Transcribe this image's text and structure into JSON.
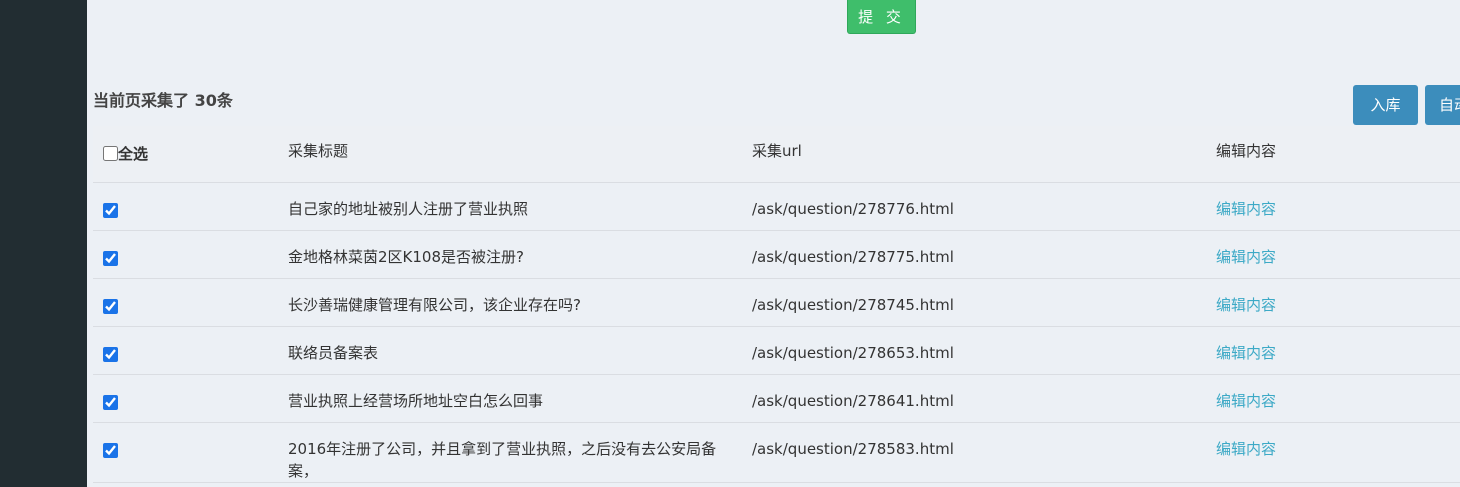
{
  "submit": {
    "label": "提 交",
    "color": "#3fbe6b"
  },
  "summary": {
    "text": "当前页采集了 30条"
  },
  "actions": {
    "import_label": "入库",
    "auto_label": "自动",
    "color": "#3c8dbc"
  },
  "table": {
    "headers": {
      "select_all": "全选",
      "title": "采集标题",
      "url": "采集url",
      "edit": "编辑内容"
    },
    "rows": [
      {
        "checked": true,
        "title": "自己家的地址被别人注册了营业执照",
        "url": "/ask/question/278776.html",
        "edit": "编辑内容"
      },
      {
        "checked": true,
        "title": "金地格林菜茵2区K108是否被注册?",
        "url": "/ask/question/278775.html",
        "edit": "编辑内容"
      },
      {
        "checked": true,
        "title": "长沙善瑞健康管理有限公司，该企业存在吗?",
        "url": "/ask/question/278745.html",
        "edit": "编辑内容"
      },
      {
        "checked": true,
        "title": "联络员备案表",
        "url": "/ask/question/278653.html",
        "edit": "编辑内容"
      },
      {
        "checked": true,
        "title": "营业执照上经营场所地址空白怎么回事",
        "url": "/ask/question/278641.html",
        "edit": "编辑内容"
      },
      {
        "checked": true,
        "title": "2016年注册了公司，并且拿到了营业执照，之后没有去公安局备案，",
        "url": "/ask/question/278583.html",
        "edit": "编辑内容"
      }
    ],
    "link_color": "#3ca9c6"
  }
}
